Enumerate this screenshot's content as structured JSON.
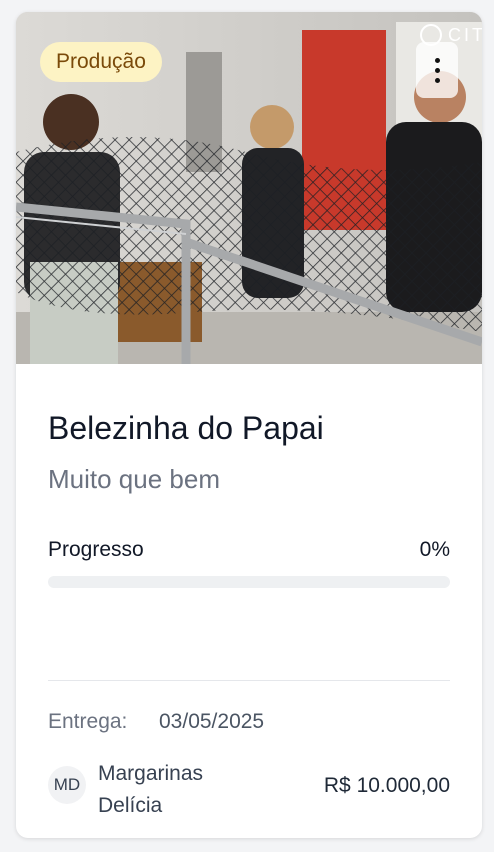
{
  "card": {
    "status": "Produção",
    "brand": "CIT",
    "title": "Belezinha do Papai",
    "subtitle": "Muito que bem",
    "progress": {
      "label": "Progresso",
      "value_text": "0%",
      "fraction": 0
    },
    "delivery": {
      "label": "Entrega:",
      "date": "03/05/2025"
    },
    "owner": {
      "initials": "MD",
      "name_line1": "Margarinas",
      "name_line2": "Delícia"
    },
    "value": "R$ 10.000,00"
  },
  "icons": {
    "menu": "more-vertical-icon",
    "brand": "brand-logo-icon"
  },
  "colors": {
    "badge_bg": "#fdf3c4",
    "badge_text": "#7a4a0a",
    "title": "#111827",
    "muted": "#6b7280",
    "track": "#eef0f2"
  }
}
